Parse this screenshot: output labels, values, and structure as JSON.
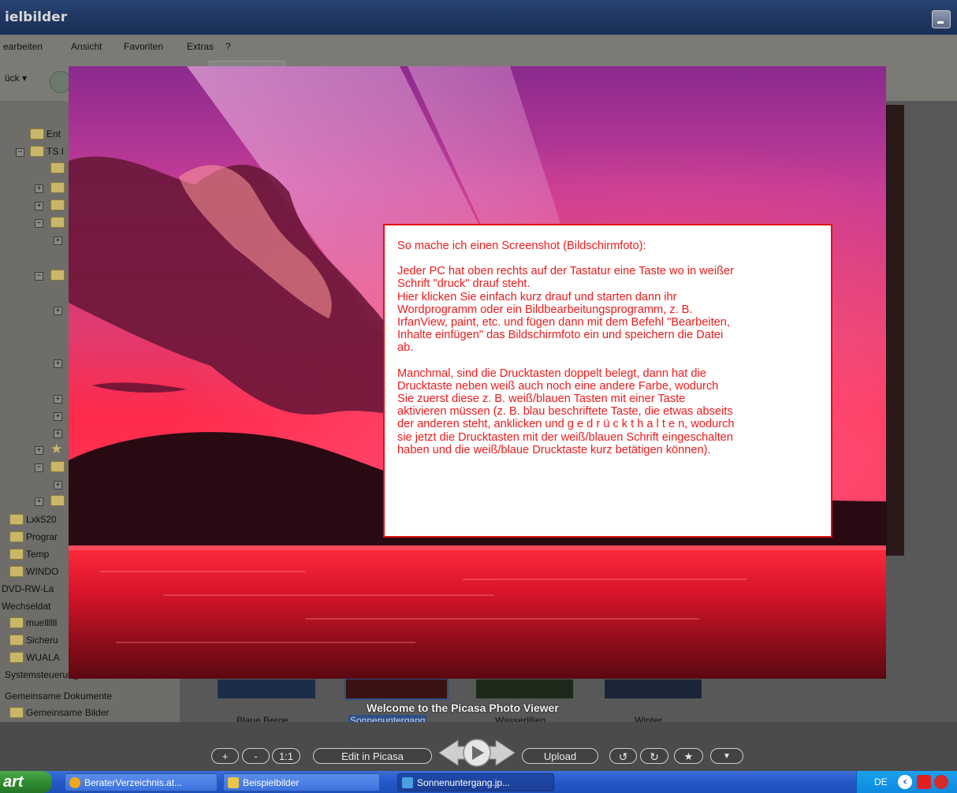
{
  "window": {
    "title": "ielbilder"
  },
  "menu": [
    "earbeiten",
    "Ansicht",
    "Favoriten",
    "Extras",
    "?"
  ],
  "toolbar": {
    "back_label": "ück"
  },
  "tree": {
    "items": [
      "Ent",
      "TS I",
      "Lxk520",
      "Prograr",
      "Temp",
      "WINDO",
      "DVD-RW-La",
      "Wechseldat",
      "muellllll",
      "Sicheru",
      "WUALA",
      "Systemsteuerung",
      "Gemeinsame Dokumente",
      "Gemeinsame Bilder"
    ]
  },
  "thumbnails": [
    "Blaue Berge",
    "Sonnenuntergang",
    "Wasserlilien",
    "Winter"
  ],
  "note": {
    "colors": {
      "text": "#ee1a1a",
      "border": "#e01010"
    },
    "paragraphs": [
      "So mache ich einen Screenshot (Bildschirmfoto):",
      "Jeder PC hat oben rechts auf der Tastatur eine Taste wo in weißer\nSchrift \"druck\" drauf steht.\nHier klicken Sie einfach kurz drauf und starten dann ihr\nWordprogramm oder ein Bildbearbeitungsprogramm, z. B.\nIrfanView, paint, etc. und fügen dann mit dem Befehl \"Bearbeiten,\nInhalte einfügen\" das Bildschirmfoto ein und speichern die Datei\nab.",
      "Manchmal, sind die Drucktasten doppelt belegt, dann hat die\nDrucktaste neben weiß auch noch eine andere Farbe, wodurch\nSie zuerst diese z. B. weiß/blauen Tasten mit einer Taste\naktivieren müssen (z. B. blau beschriftete Taste, die etwas abseits\nder anderen steht, anklicken und g e d r ü c k t  h a l t e n, wodurch\nsie jetzt die Drucktasten mit der weiß/blauen Schrift eingeschalten\nhaben und die weiß/blaue Drucktaste kurz betätigen können)."
    ]
  },
  "picasa": {
    "welcome": "Welcome to the Picasa Photo Viewer",
    "zoom_in": "+",
    "zoom_out": "-",
    "actual_size": "1:1",
    "edit": "Edit in Picasa",
    "upload": "Upload",
    "rotate_left": "↺",
    "rotate_right": "↻",
    "star": "★",
    "more": "▼"
  },
  "taskbar": {
    "start": "art",
    "tasks": [
      "BeraterVerzeichnis.at...",
      "Beispielbilder",
      "Sonnenuntergang.jp..."
    ],
    "lang": "DE"
  }
}
